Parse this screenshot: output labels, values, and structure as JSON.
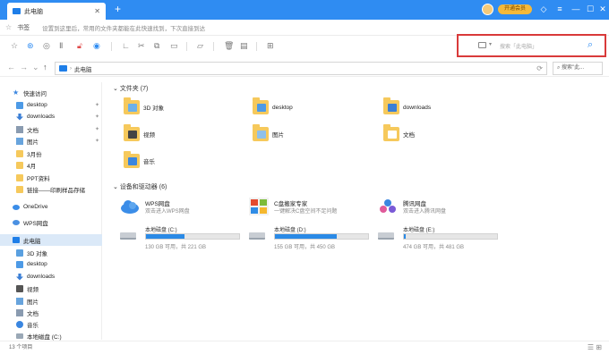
{
  "window": {
    "tab_title": "此电脑",
    "vip_label": "开通会员"
  },
  "tips": {
    "home_label": "书签",
    "hint": "设置到这里后，常用的文件夹都能在此快速找到，下次直接到达"
  },
  "search": {
    "placeholder": "搜索「此电脑」"
  },
  "nav": {
    "location": "此电脑",
    "search_label": "搜索\"此..."
  },
  "sidebar": {
    "items": [
      {
        "label": "快速访问",
        "icon": "star-icon",
        "pinned": false
      },
      {
        "label": "desktop",
        "icon": "desktop-icon",
        "pinned": true
      },
      {
        "label": "downloads",
        "icon": "download-icon",
        "pinned": true
      },
      {
        "label": "文档",
        "icon": "document-icon",
        "pinned": true
      },
      {
        "label": "图片",
        "icon": "picture-icon",
        "pinned": true
      },
      {
        "label": "3月份",
        "icon": "folder-icon",
        "pinned": false
      },
      {
        "label": "4月",
        "icon": "folder-icon",
        "pinned": false
      },
      {
        "label": "PPT资料",
        "icon": "folder-icon",
        "pinned": false
      },
      {
        "label": "链接——印刷样品存储",
        "icon": "folder-icon",
        "pinned": false
      },
      {
        "label": "OneDrive",
        "icon": "cloud-icon",
        "pinned": false
      },
      {
        "label": "WPS网盘",
        "icon": "wps-cloud-icon",
        "pinned": false
      },
      {
        "label": "此电脑",
        "icon": "computer-icon",
        "pinned": false,
        "selected": true
      },
      {
        "label": "3D 对象",
        "icon": "3d-objects-icon",
        "pinned": false
      },
      {
        "label": "desktop",
        "icon": "desktop-icon",
        "pinned": false
      },
      {
        "label": "downloads",
        "icon": "download-icon",
        "pinned": false
      },
      {
        "label": "视频",
        "icon": "video-icon",
        "pinned": false
      },
      {
        "label": "图片",
        "icon": "picture-icon",
        "pinned": false
      },
      {
        "label": "文档",
        "icon": "document-icon",
        "pinned": false
      },
      {
        "label": "音乐",
        "icon": "music-icon",
        "pinned": false
      },
      {
        "label": "本地磁盘 (C:)",
        "icon": "drive-icon",
        "pinned": false
      }
    ]
  },
  "content": {
    "folders_header": "文件夹 (7)",
    "folders": [
      {
        "label": "3D 对象",
        "overlay": "#6bb0ea"
      },
      {
        "label": "desktop",
        "overlay": "#4d9ae6"
      },
      {
        "label": "downloads",
        "overlay": "#3b7fd6"
      },
      {
        "label": "视频",
        "overlay": "#444444"
      },
      {
        "label": "图片",
        "overlay": "#8fc0ea"
      },
      {
        "label": "文档",
        "overlay": "#ffffff"
      },
      {
        "label": "音乐",
        "overlay": "#3a86e0"
      }
    ],
    "devices_header": "设备和驱动器 (6)",
    "apps": [
      {
        "name": "WPS网盘",
        "sub": "双击进入WPS网盘",
        "icon": "wps-cloud-icon"
      },
      {
        "name": "C盘搬家专家",
        "sub": "一键解决C盘空间不足问题",
        "icon": "windows-icon"
      },
      {
        "name": "腾讯网盘",
        "sub": "双击进入腾讯网盘",
        "icon": "cloud-app-icon"
      }
    ],
    "drives": [
      {
        "name": "本地磁盘 (C:)",
        "sub": "130 GB 可用，共 221 GB",
        "used": 0.41
      },
      {
        "name": "本地磁盘 (D:)",
        "sub": "155 GB 可用，共 450 GB",
        "used": 0.66
      },
      {
        "name": "本地磁盘 (E:)",
        "sub": "474 GB 可用，共 481 GB",
        "used": 0.02
      }
    ]
  },
  "status": {
    "count": "13 个项目"
  }
}
